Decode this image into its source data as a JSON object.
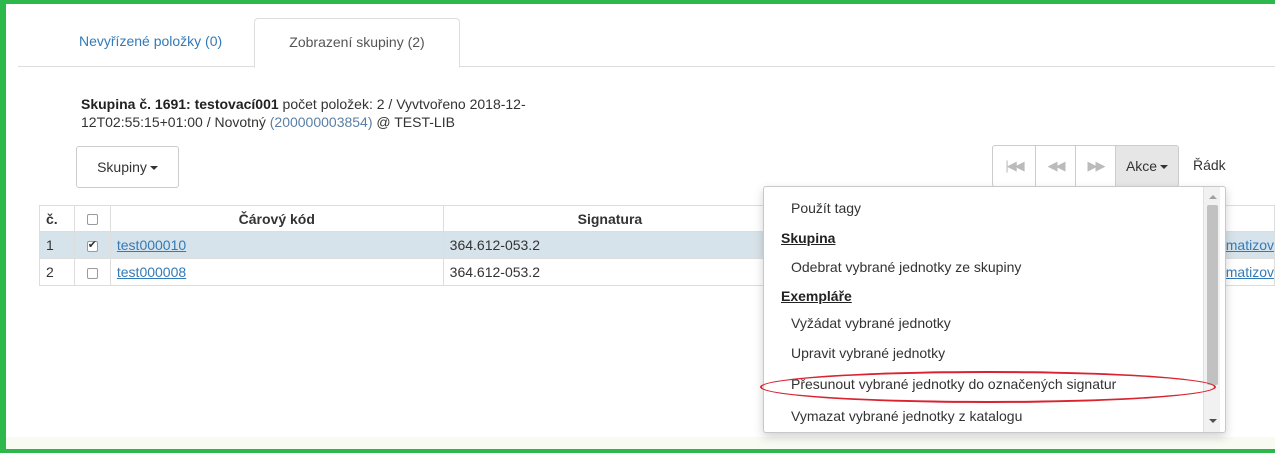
{
  "tabs": [
    {
      "label": "Nevyřízené položky (0)"
    },
    {
      "label": "Zobrazení skupiny (2)"
    }
  ],
  "info": {
    "prefix": "Skupina č. 1691: testovací001",
    "count_created": " počet položek: 2 / Vyvtvořeno 2018-12-",
    "line2_start": "12T02:55:15+01:00 / Novotný ",
    "id_link": "(200000003854)",
    "line2_end": " @ TEST-LIB"
  },
  "buttons": {
    "skupiny": "Skupiny",
    "akce": "Akce",
    "radky": "Řádk"
  },
  "pager": {
    "first": "◀◀",
    "prev": "◀◀",
    "next": "▶▶"
  },
  "table": {
    "headers": [
      "č.",
      "",
      "Čárový kód",
      "Signatura"
    ],
    "rows": [
      {
        "num": "1",
        "checked": true,
        "barcode": "test000010",
        "signature": "364.612-053.2",
        "rest": "matizov"
      },
      {
        "num": "2",
        "checked": false,
        "barcode": "test000008",
        "signature": "364.612-053.2",
        "rest": "matizov"
      }
    ]
  },
  "menu": {
    "items": [
      {
        "type": "item",
        "label": "Použít tagy"
      },
      {
        "type": "header",
        "label": "Skupina"
      },
      {
        "type": "item",
        "label": "Odebrat vybrané jednotky ze skupiny"
      },
      {
        "type": "header",
        "label": "Exempláře"
      },
      {
        "type": "item",
        "label": "Vyžádat vybrané jednotky"
      },
      {
        "type": "item",
        "label": "Upravit vybrané jednotky"
      },
      {
        "type": "item",
        "label": "Přesunout vybrané jednotky do označených signatur"
      },
      {
        "type": "item",
        "label": "Vymazat vybrané jednotky z katalogu"
      }
    ]
  },
  "colors": {
    "frame": "#2db84b",
    "highlight": "#d9232f",
    "link": "#337ab7",
    "selected_row": "#d7e3ea"
  }
}
